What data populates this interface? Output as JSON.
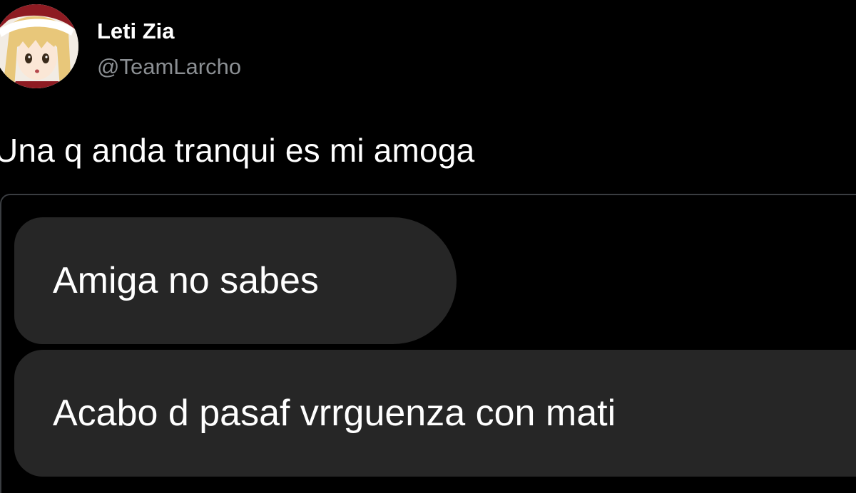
{
  "author": {
    "display_name": "Leti Zia",
    "handle": "@TeamLarcho",
    "avatar_icon": "anime-avatar-icon"
  },
  "tweet": {
    "text": "Una q anda tranqui es mi amoga"
  },
  "chat_screenshot": {
    "messages": [
      {
        "text": "Amiga no sabes"
      },
      {
        "text": "Acabo d pasaf vrrguenza con mati"
      }
    ]
  },
  "colors": {
    "background": "#000000",
    "bubble": "#262626",
    "handle_gray": "#8b8f93",
    "border": "#3a3d41"
  }
}
